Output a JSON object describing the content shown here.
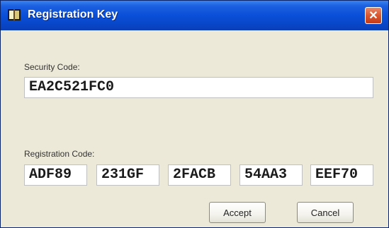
{
  "window": {
    "title": "Registration Key",
    "close_label": "✕"
  },
  "security": {
    "label": "Security Code:",
    "value": "EA2C521FC0"
  },
  "registration": {
    "label": "Registration Code:",
    "segments": [
      "ADF89",
      "231GF",
      "2FACB",
      "54AA3",
      "EEF70"
    ]
  },
  "buttons": {
    "accept_label": "Accept",
    "cancel_label": "Cancel"
  },
  "icons": {
    "app": "app-icon",
    "close": "close-icon"
  }
}
